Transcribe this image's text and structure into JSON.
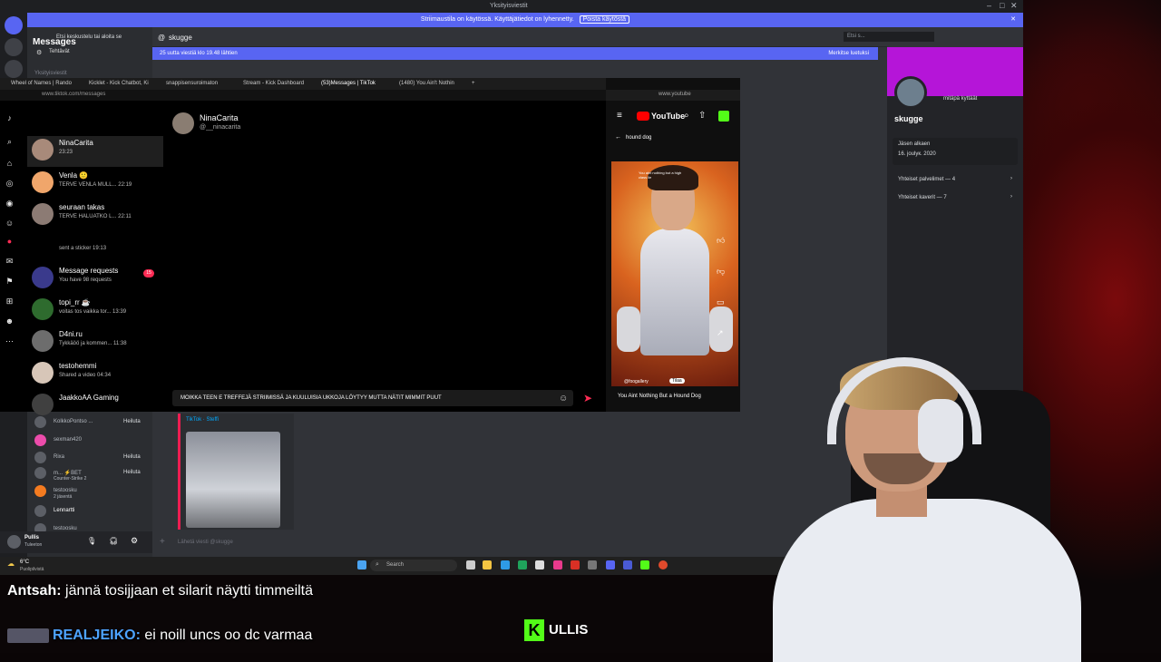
{
  "window": {
    "title": "Yksityisviestit",
    "notice": "Striimaustila on käytössä. Käyttäjätiedot on lyhennetty.",
    "notice_button": "Poista käytöstä"
  },
  "discord": {
    "search_placeholder": "Etsi keskustelu tai aloita se",
    "tasks_label": "Tehtävät",
    "dm_section": "Yksityisviestit",
    "dm_user": "skugge",
    "new_messages_bar": "25 uutta viestiä klo 19.48 lähtien",
    "mark_read": "Merkitse luetuksi",
    "header_search": "Etsi s...",
    "profile": {
      "name": "skugge",
      "status": "mitäpä kyttäät",
      "member_since_label": "Jäsen alkaen",
      "member_since": "16. joulук. 2020",
      "mutual_servers": "Yhteiset palvelimet — 4",
      "mutual_friends": "Yhteiset kaverit — 7"
    },
    "members": [
      {
        "name": "KolkkoPontso ...",
        "action": "Heiluta"
      },
      {
        "name": "sexman420",
        "action": ""
      },
      {
        "name": "Rixa",
        "action": "Heiluta"
      },
      {
        "name": "m... ⚡BET",
        "sub": "Counter-Strike 2",
        "action": "Heiluta"
      },
      {
        "name": "testoosku",
        "sub": "2 jäsentä",
        "action": ""
      },
      {
        "name": "Lennartti",
        "action": ""
      },
      {
        "name": "testoosku",
        "action": ""
      }
    ],
    "user": {
      "name": "Pullis",
      "status": "Tuleeton"
    },
    "embed_label": "TikTok · Steffi",
    "composer_placeholder": "Lähetä viesti @skugge"
  },
  "browser": {
    "tabs": [
      "Wheel of Names | Rando",
      "Kicklet - Kick Chatbot, Ki",
      "snappisensuroimaton",
      "Stream - Kick Dashboard",
      "(53)Messages | TikTok",
      "(1480) You Ain't Nothin"
    ],
    "url": "www.tiktok.com/messages"
  },
  "tiktok": {
    "title": "Messages",
    "conversations": [
      {
        "name": "NinaCarita",
        "sub": "23:23",
        "selected": true
      },
      {
        "name": "Venla 🙂",
        "sub": "TERVE VENLA MULL... 22:19"
      },
      {
        "name": "seuraan takas",
        "sub": "TERVE HALUATKO L... 22:11"
      },
      {
        "name": "",
        "sub": "sent a sticker 19:13"
      },
      {
        "name": "Message requests",
        "sub": "You have 98 requests",
        "badge": "15"
      },
      {
        "name": "topi_rr ☕",
        "sub": "voitas tos vaikka tor... 13:39"
      },
      {
        "name": "D4ni.ru",
        "sub": "Tykkäöö ja kommen... 11:38"
      },
      {
        "name": "testohemmi",
        "sub": "Shared a video 04:34"
      },
      {
        "name": "JaakkoAA Gaming",
        "sub": ""
      }
    ],
    "chat_user": "NinaCarita",
    "chat_handle": "@__ninacarita",
    "draft": "MOIKKA TEEN E TREFFEJÄ STRIIMISSÄ JA KUULUISIA UKKOJA LÖYTYY MUTTA NÄTIT MIMMIT PUUT"
  },
  "youtube": {
    "url": "www.youtube",
    "logo": "YouTube",
    "back_label": "hound dog",
    "channel": "@foogallery",
    "subscribe": "Tilaa",
    "video_title": "You Aint Nothing But a Hound Dog",
    "overlay_text": "You aint nothing but a high class lie"
  },
  "taskbar": {
    "weather": "6°C",
    "weather_sub": "Puolipilvistä",
    "search": "Search"
  },
  "stream_chat": [
    {
      "user": "Antsah:",
      "text": "jännä tosijjaan et silarit näytti timmeiltä"
    },
    {
      "user": "REALJEIKO:",
      "text": "ei noill uncs oo dc varmaa"
    }
  ],
  "kick": {
    "logo": "K",
    "name": "ULLIS"
  },
  "colors": {
    "discord_blurple": "#5865f2",
    "tiktok_red": "#fe2c55",
    "kick_green": "#53fc18",
    "profile_banner": "#b515d8"
  }
}
